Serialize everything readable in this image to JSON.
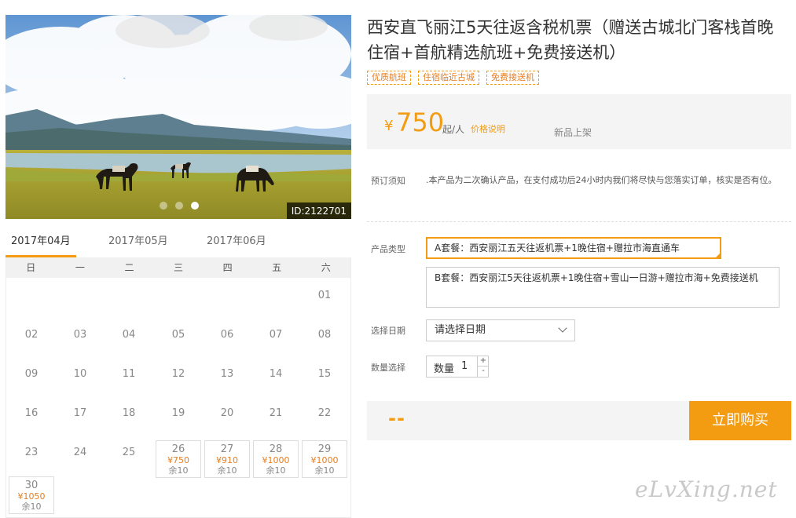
{
  "product": {
    "title": "西安直飞丽江5天往返含税机票（赠送古城北门客栈首晚住宿+首航精选航班+免费接送机）",
    "tags": [
      "优质航班",
      "住宿临近古城",
      "免费接送机"
    ],
    "photo_id": "ID:2122701",
    "carousel": {
      "count": 3,
      "active": 3
    }
  },
  "price": {
    "currency": "¥",
    "amount": "750",
    "unit": "起/人",
    "note_link": "价格说明",
    "badge": "新品上架"
  },
  "notice": {
    "label": "预订须知",
    "text": ".本产品为二次确认产品，在支付成功后24小时内我们将尽快与您落实订单，核实是否有位。"
  },
  "options": {
    "package_label": "产品类型",
    "packages": [
      {
        "label": "A套餐：西安丽江五天往返机票+1晚住宿+赠拉市海直通车",
        "selected": true
      },
      {
        "label": "B套餐：西安丽江5天往返机票+1晚住宿+雪山一日游+赠拉市海+免费接送机",
        "selected": false
      }
    ],
    "date_label": "选择日期",
    "date_value": "请选择日期",
    "qty_label": "数量选择",
    "qty_field": "数量",
    "qty_value": "1",
    "plus": "+",
    "minus": "-"
  },
  "buy": {
    "price_placeholder": "--",
    "button": "立即购买"
  },
  "calendar": {
    "months": [
      "2017年04月",
      "2017年05月",
      "2017年06月"
    ],
    "active_month": 0,
    "weekdays": [
      "日",
      "一",
      "二",
      "三",
      "四",
      "五",
      "六"
    ],
    "first_weekday": 6,
    "days_in_month": 30,
    "priced_days": [
      {
        "day": "26",
        "price": "¥750",
        "stock": "余10"
      },
      {
        "day": "27",
        "price": "¥910",
        "stock": "余10"
      },
      {
        "day": "28",
        "price": "¥1000",
        "stock": "余10"
      },
      {
        "day": "29",
        "price": "¥1000",
        "stock": "余10"
      },
      {
        "day": "30",
        "price": "¥1050",
        "stock": "余10"
      }
    ]
  },
  "watermark": "eLvXing.net",
  "colors": {
    "accent": "#f39c12",
    "panel": "#f4f4f4",
    "text": "#333333"
  }
}
